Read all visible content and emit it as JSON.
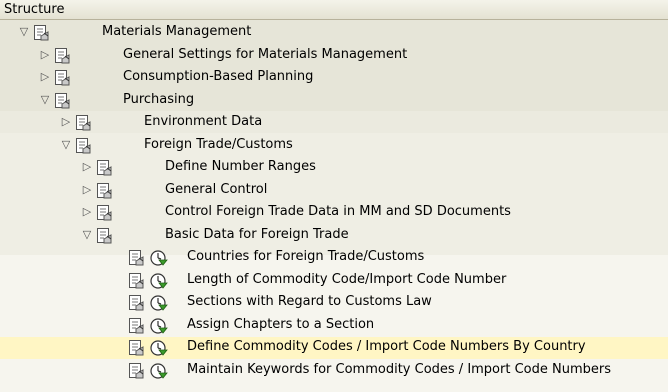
{
  "header": {
    "title": "Structure"
  },
  "tree": [
    {
      "label": "Materials Management",
      "toggle": "expanded",
      "icon": "doc-node-icon"
    },
    {
      "label": "General Settings for Materials Management",
      "toggle": "collapsed",
      "icon": "doc-node-icon"
    },
    {
      "label": "Consumption-Based Planning",
      "toggle": "collapsed",
      "icon": "doc-node-icon"
    },
    {
      "label": "Purchasing",
      "toggle": "expanded",
      "icon": "doc-node-icon"
    },
    {
      "label": "Environment Data",
      "toggle": "collapsed",
      "icon": "doc-node-icon"
    },
    {
      "label": "Foreign Trade/Customs",
      "toggle": "expanded",
      "icon": "doc-node-icon"
    },
    {
      "label": "Define Number Ranges",
      "toggle": "collapsed",
      "icon": "doc-node-icon"
    },
    {
      "label": "General Control",
      "toggle": "collapsed",
      "icon": "doc-node-icon"
    },
    {
      "label": "Control Foreign Trade Data in MM and SD Documents",
      "toggle": "collapsed",
      "icon": "doc-node-icon"
    },
    {
      "label": "Basic Data for Foreign Trade",
      "toggle": "expanded",
      "icon": "doc-node-icon"
    },
    {
      "label": "Countries for Foreign Trade/Customs",
      "icon": "doc-node-icon",
      "action": "execute-clock-icon"
    },
    {
      "label": "Length of Commodity Code/Import Code Number",
      "icon": "doc-node-icon",
      "action": "execute-clock-icon"
    },
    {
      "label": "Sections with Regard to Customs Law",
      "icon": "doc-node-icon",
      "action": "execute-clock-icon"
    },
    {
      "label": "Assign Chapters to a Section",
      "icon": "doc-node-icon",
      "action": "execute-clock-icon"
    },
    {
      "label": "Define Commodity Codes / Import Code Numbers By Country",
      "icon": "doc-node-icon",
      "action": "execute-clock-icon",
      "selected": true
    },
    {
      "label": "Maintain Keywords for Commodity Codes / Import Code Numbers",
      "icon": "doc-node-icon",
      "action": "execute-clock-icon"
    }
  ],
  "colors": {
    "background": "#f2f1e6",
    "band_level2": "#e9e8dc",
    "band_level3": "#efeee3",
    "band_leaf": "#f6f5ee",
    "selected": "#fff6c4"
  }
}
